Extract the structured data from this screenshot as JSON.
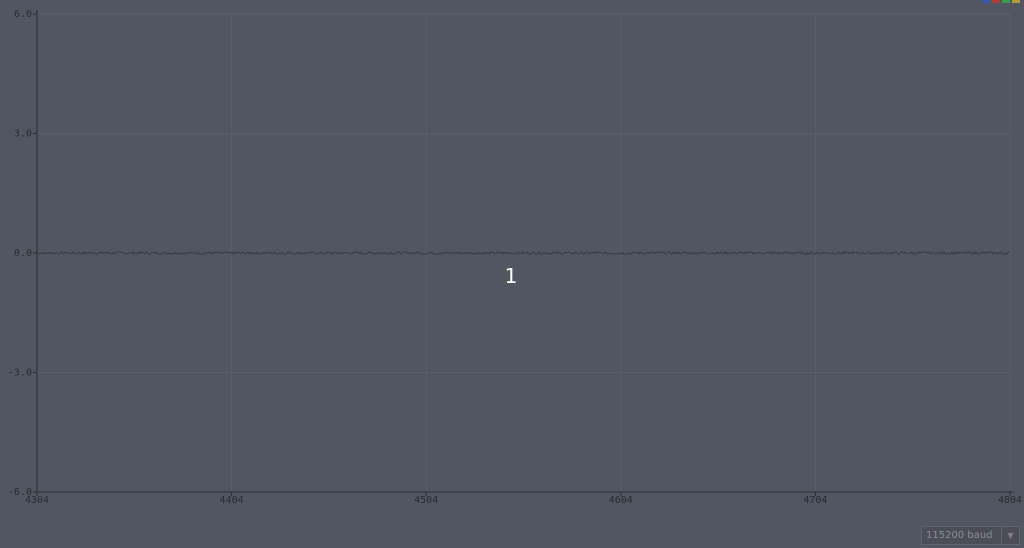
{
  "chart_data": {
    "type": "line",
    "title": "",
    "xlabel": "",
    "ylabel": "",
    "xlim": [
      4304,
      4804
    ],
    "ylim": [
      -6.0,
      6.0
    ],
    "x_ticks": [
      "4304",
      "4404",
      "4504",
      "4604",
      "4704",
      "4804"
    ],
    "y_ticks": [
      "6.0",
      "3.0",
      "0.0",
      "-3.0",
      "-6.0"
    ],
    "grid": true,
    "series": [
      {
        "value": 0.0,
        "noise": 0.03,
        "color": "#3c3e44"
      }
    ],
    "annotation": "1"
  },
  "legend_colors": [
    "#3a5ab0",
    "#b03a3a",
    "#3aa050",
    "#b09a3a"
  ],
  "colors": {
    "background": "#525660",
    "axis": "#2a2c30",
    "grid": "#5a5e68"
  },
  "baud": {
    "value": "115200 baud",
    "arrow": "▼"
  }
}
